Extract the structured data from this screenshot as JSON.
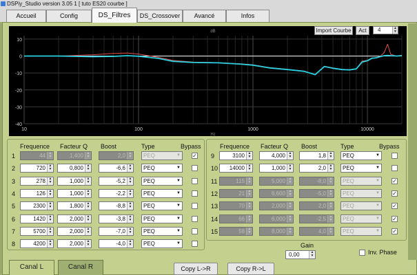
{
  "window": {
    "title": "DSPiy_Studio version 3.05 1 [ tuto ES20 courbe ]"
  },
  "tabs": [
    {
      "label": "Accueil",
      "active": false
    },
    {
      "label": "Config",
      "active": false
    },
    {
      "label": "DS_Filtres",
      "active": true
    },
    {
      "label": "DS_Crossover",
      "active": false
    },
    {
      "label": "Avancé",
      "active": false
    },
    {
      "label": "Infos",
      "active": false
    }
  ],
  "graph": {
    "import_label": "Import Courbe",
    "act_label": "Act",
    "act_value": "4",
    "axis_x_label": "Hz",
    "axis_y_label": "dB",
    "x_ticks": [
      "10",
      "100",
      "1000",
      "10000"
    ],
    "y_ticks": [
      "10",
      "0",
      "-10",
      "-20",
      "-30",
      "-40"
    ],
    "line_colors": {
      "measured": "#e05050",
      "corrected": "#ffffff",
      "result": "#28d0e0"
    }
  },
  "chart_data": {
    "type": "line",
    "x_scale": "log",
    "xlim": [
      10,
      20000
    ],
    "ylim": [
      -40,
      12
    ],
    "series": [
      {
        "color": "#e05050",
        "x": [
          10,
          20,
          40,
          60,
          80,
          100,
          150,
          200,
          300,
          500,
          800,
          1000,
          1400,
          2000,
          2800,
          3500,
          4200,
          5000,
          6000,
          7000,
          8000,
          9000,
          10000,
          11000,
          12000,
          13000,
          14000,
          15000,
          16000,
          18000,
          20000
        ],
        "y": [
          0,
          0,
          0.8,
          1.5,
          1.8,
          1.2,
          -0.8,
          -2.6,
          -3.5,
          -3.9,
          -4.6,
          -5.2,
          -6.8,
          -7.8,
          -8.9,
          -11.0,
          -6.0,
          -7.0,
          -7.8,
          -8.0,
          -7.5,
          -3.0,
          -2.5,
          -1.0,
          -1.2,
          0.0,
          2.0,
          7.0,
          1.0,
          0.0,
          0.5
        ]
      },
      {
        "color": "#28d0e0",
        "x": [
          10,
          20,
          40,
          60,
          80,
          100,
          150,
          200,
          300,
          500,
          800,
          1000,
          1400,
          2000,
          2800,
          3500,
          4200,
          5000,
          6000,
          7000,
          8000,
          9000,
          10000,
          11000,
          12000,
          13000,
          14000,
          15000,
          16000,
          18000,
          20000
        ],
        "y": [
          0,
          0,
          -0.4,
          -0.2,
          0.2,
          -0.1,
          -1.4,
          -3.1,
          -3.8,
          -4.0,
          -4.8,
          -5.4,
          -7.0,
          -8.0,
          -9.0,
          -11.0,
          -6.2,
          -7.2,
          -8.0,
          -8.2,
          -7.6,
          -3.5,
          -2.8,
          -1.3,
          -1.0,
          -0.3,
          0.2,
          0.4,
          0.2,
          0.0,
          0.2
        ]
      }
    ]
  },
  "filters": {
    "headers": {
      "freq": "Frequence",
      "q": "Facteur Q",
      "boost": "Boost",
      "type": "Type",
      "bypass": "Bypass"
    },
    "left": [
      {
        "n": "1",
        "freq": "44",
        "q": "1,400",
        "boost": "2,0",
        "type": "PEQ",
        "bypass": true,
        "enabled": false
      },
      {
        "n": "2",
        "freq": "720",
        "q": "0,800",
        "boost": "-6,6",
        "type": "PEQ",
        "bypass": false,
        "enabled": true
      },
      {
        "n": "3",
        "freq": "278",
        "q": "1,000",
        "boost": "-5,2",
        "type": "PEQ",
        "bypass": false,
        "enabled": true
      },
      {
        "n": "4",
        "freq": "126",
        "q": "1,000",
        "boost": "-2,2",
        "type": "PEQ",
        "bypass": false,
        "enabled": true
      },
      {
        "n": "5",
        "freq": "2300",
        "q": "1,800",
        "boost": "-8,8",
        "type": "PEQ",
        "bypass": false,
        "enabled": true
      },
      {
        "n": "6",
        "freq": "1420",
        "q": "2,000",
        "boost": "-3,8",
        "type": "PEQ",
        "bypass": false,
        "enabled": true
      },
      {
        "n": "7",
        "freq": "5700",
        "q": "2,000",
        "boost": "-7,0",
        "type": "PEQ",
        "bypass": false,
        "enabled": true
      },
      {
        "n": "8",
        "freq": "4200",
        "q": "2,000",
        "boost": "-4,0",
        "type": "PEQ",
        "bypass": false,
        "enabled": true
      }
    ],
    "right": [
      {
        "n": "9",
        "freq": "3100",
        "q": "4,000",
        "boost": "1,8",
        "type": "PEQ",
        "bypass": false,
        "enabled": true
      },
      {
        "n": "10",
        "freq": "14000",
        "q": "1,000",
        "boost": "2,0",
        "type": "PEQ",
        "bypass": false,
        "enabled": true
      },
      {
        "n": "11",
        "freq": "115",
        "q": "5,000",
        "boost": "-8,0",
        "type": "PEQ",
        "bypass": true,
        "enabled": false
      },
      {
        "n": "12",
        "freq": "21",
        "q": "6,600",
        "boost": "-5,0",
        "type": "PEQ",
        "bypass": true,
        "enabled": false
      },
      {
        "n": "13",
        "freq": "70",
        "q": "2,000",
        "boost": "2,0",
        "type": "PEQ",
        "bypass": true,
        "enabled": false
      },
      {
        "n": "14",
        "freq": "66",
        "q": "6,000",
        "boost": "-2,5",
        "type": "PEQ",
        "bypass": true,
        "enabled": false
      },
      {
        "n": "15",
        "freq": "58",
        "q": "8,000",
        "boost": "4,0",
        "type": "PEQ",
        "bypass": true,
        "enabled": false
      }
    ]
  },
  "gain": {
    "label": "Gain",
    "value": "0,00"
  },
  "inv_phase": {
    "label": "Inv. Phase",
    "checked": false
  },
  "bottom": {
    "canal_l": "Canal L",
    "canal_r": "Canal R",
    "copy_lr": "Copy L->R",
    "copy_rl": "Copy R->L"
  },
  "colors": {
    "panel": "#c3d08e",
    "frame": "#9aa96c",
    "graph_bg": "#000000"
  }
}
